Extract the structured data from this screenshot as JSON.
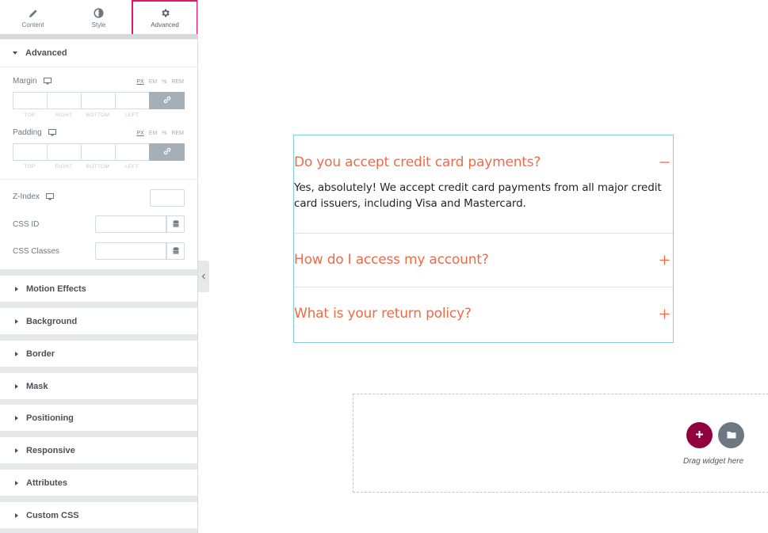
{
  "tabs": [
    {
      "label": "Content",
      "icon": "pencil-icon"
    },
    {
      "label": "Style",
      "icon": "half-circle-icon"
    },
    {
      "label": "Advanced",
      "icon": "gear-icon",
      "active": true
    }
  ],
  "advanced_section": {
    "title": "Advanced",
    "margin": {
      "label": "Margin",
      "units": [
        "PX",
        "EM",
        "%",
        "REM"
      ],
      "selected_unit": "PX",
      "sides": [
        "TOP",
        "RIGHT",
        "BOTTOM",
        "LEFT"
      ]
    },
    "padding": {
      "label": "Padding",
      "units": [
        "PX",
        "EM",
        "%",
        "REM"
      ],
      "selected_unit": "PX",
      "sides": [
        "TOP",
        "RIGHT",
        "BOTTOM",
        "LEFT"
      ]
    },
    "z_index_label": "Z-Index",
    "css_id_label": "CSS ID",
    "css_classes_label": "CSS Classes"
  },
  "collapsed_sections": [
    "Motion Effects",
    "Background",
    "Border",
    "Mask",
    "Positioning",
    "Responsive",
    "Attributes",
    "Custom CSS"
  ],
  "accordion": {
    "items": [
      {
        "title": "Do you accept credit card payments?",
        "expanded": true,
        "body": "Yes, absolutely! We accept credit card payments from all major credit card issuers, including Visa and Mastercard."
      },
      {
        "title": "How do I access my account?",
        "expanded": false
      },
      {
        "title": "What is your return policy?",
        "expanded": false
      }
    ],
    "title_color": "#f06a47",
    "border_color": "#7fd0da"
  },
  "dropzone": {
    "text": "Drag widget here"
  },
  "colors": {
    "accent_pink": "#e2166a",
    "add_button": "#93003f",
    "folder_button": "#6d7882"
  }
}
